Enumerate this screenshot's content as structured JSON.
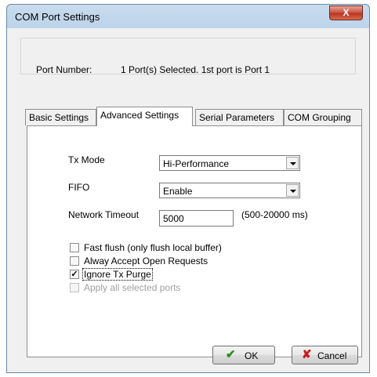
{
  "window": {
    "title": "COM Port Settings",
    "close_glyph": "X"
  },
  "port": {
    "label": "Port Number:",
    "value": "1 Port(s) Selected. 1st port is Port 1"
  },
  "tabs": [
    {
      "label": "Basic Settings",
      "active": false
    },
    {
      "label": "Advanced Settings",
      "active": true
    },
    {
      "label": "Serial Parameters",
      "active": false
    },
    {
      "label": "COM Grouping",
      "active": false
    }
  ],
  "advanced": {
    "tx_mode": {
      "label": "Tx Mode",
      "value": "Hi-Performance"
    },
    "fifo": {
      "label": "FIFO",
      "value": "Enable"
    },
    "network_timeout": {
      "label": "Network Timeout",
      "value": "5000",
      "hint": "(500-20000 ms)"
    },
    "checkboxes": [
      {
        "label": "Fast flush (only flush local buffer)",
        "checked": false,
        "enabled": true
      },
      {
        "label": "Alway Accept Open Requests",
        "checked": false,
        "enabled": true
      },
      {
        "label": "Ignore Tx Purge",
        "checked": true,
        "enabled": true
      },
      {
        "label": "Apply all selected ports",
        "checked": false,
        "enabled": false
      }
    ]
  },
  "buttons": {
    "ok": {
      "label": "OK",
      "icon": "checkmark-icon",
      "color": "#2e8b1f"
    },
    "cancel": {
      "label": "Cancel",
      "icon": "red-x-icon",
      "color": "#cc1a1a"
    }
  }
}
